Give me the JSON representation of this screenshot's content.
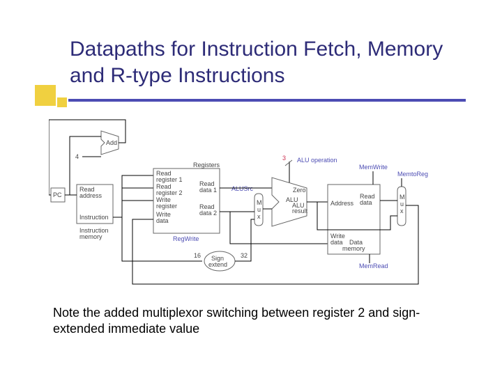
{
  "title": "Datapaths for Instruction Fetch, Memory and R-type Instructions",
  "caption": "Note the added multiplexor switching between register 2 and sign-extended immediate value",
  "diagram": {
    "pc": "PC",
    "instr_mem": {
      "read_addr": "Read\naddress",
      "instruction": "Instruction",
      "label": "Instruction\nmemory"
    },
    "add_4": {
      "four": "4",
      "add": "Add"
    },
    "registers": {
      "title": "Registers",
      "rr1": "Read\nregister 1",
      "rr2": "Read\nregister 2",
      "wr": "Write\nregister",
      "wd": "Write\ndata",
      "rd1": "Read\ndata 1",
      "rd2": "Read\ndata 2",
      "regwrite": "RegWrite"
    },
    "alusrc_mux": "M\nu\nx",
    "alusrc": "ALUSrc",
    "alu": {
      "zero": "Zero",
      "label": "ALU",
      "result": "ALU\nresult"
    },
    "alu_op": {
      "bits": "3",
      "label": "ALU operation"
    },
    "sign_ext": {
      "in": "16",
      "out": "32",
      "label": "Sign\nextend"
    },
    "data_mem": {
      "memwrite": "MemWrite",
      "address": "Address",
      "writedata": "Write\ndata",
      "readdata": "Read\ndata",
      "memread": "MemRead",
      "label": "Data\nmemory"
    },
    "memtoreg_mux": "M\nu\nx",
    "memtoreg": "MemtoReg"
  }
}
